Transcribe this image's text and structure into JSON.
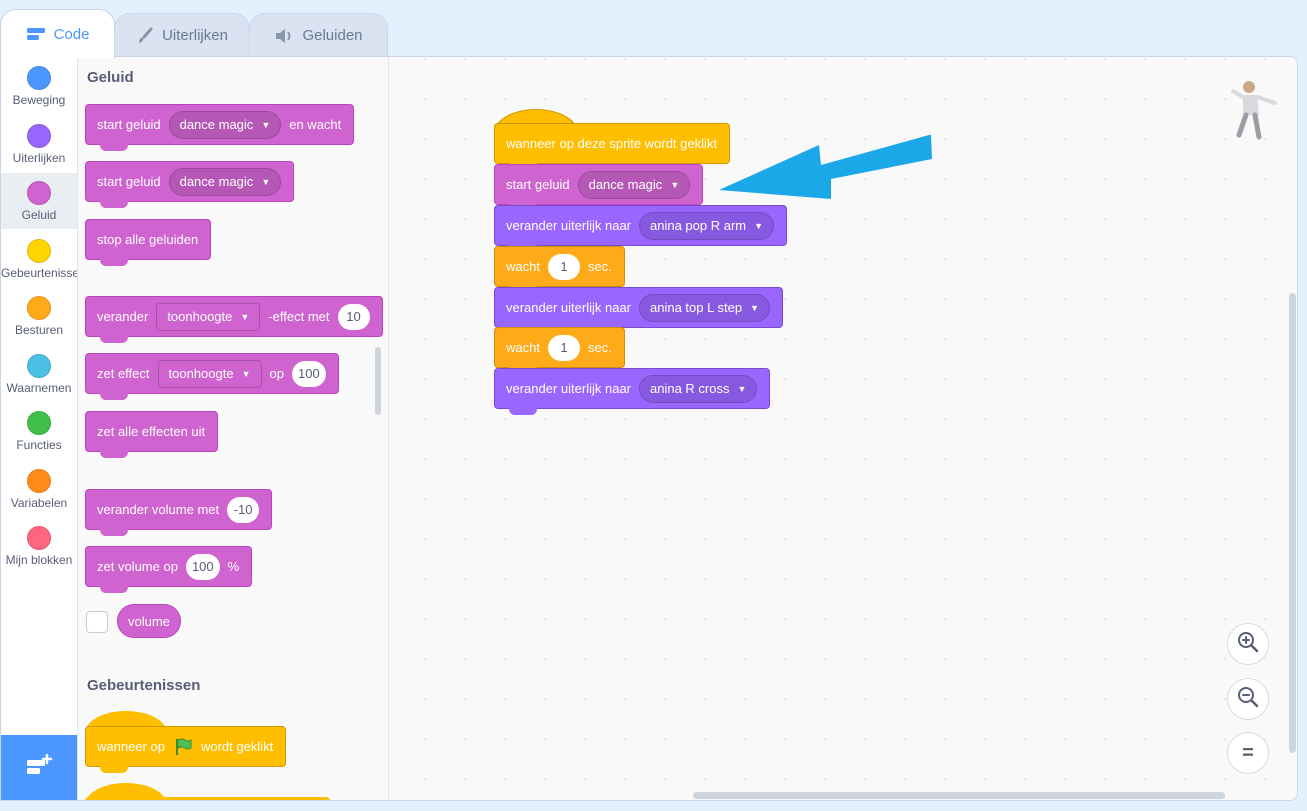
{
  "tabs": [
    {
      "label": "Code",
      "icon": "code-icon"
    },
    {
      "label": "Uiterlijken",
      "icon": "brush-icon"
    },
    {
      "label": "Geluiden",
      "icon": "speaker-icon"
    }
  ],
  "categories": [
    {
      "label": "Beweging",
      "color": "#4c97ff"
    },
    {
      "label": "Uiterlijken",
      "color": "#9966ff"
    },
    {
      "label": "Geluid",
      "color": "#cf63cf"
    },
    {
      "label": "Gebeurtenissen",
      "color": "#ffd500"
    },
    {
      "label": "Besturen",
      "color": "#ffab19"
    },
    {
      "label": "Waarnemen",
      "color": "#4cbfe6"
    },
    {
      "label": "Functies",
      "color": "#40bf4a"
    },
    {
      "label": "Variabelen",
      "color": "#ff8c1a"
    },
    {
      "label": "Mijn blokken",
      "color": "#ff6680"
    }
  ],
  "palette": {
    "heading_sound": "Geluid",
    "b1": {
      "pre": "start geluid",
      "dd": "dance magic",
      "post": "en wacht"
    },
    "b2": {
      "pre": "start geluid",
      "dd": "dance magic"
    },
    "b3": {
      "pre": "stop alle geluiden"
    },
    "b4": {
      "pre": "verander",
      "dd": "toonhoogte",
      "mid": "-effect met",
      "num": "10"
    },
    "b5": {
      "pre": "zet effect",
      "dd": "toonhoogte",
      "mid": "op",
      "num": "100"
    },
    "b6": {
      "pre": "zet alle effecten uit"
    },
    "b7": {
      "pre": "verander volume met",
      "num": "-10"
    },
    "b8": {
      "pre": "zet volume op",
      "num": "100",
      "post": "%"
    },
    "b9": {
      "reporter": "volume"
    },
    "heading_events": "Gebeurtenissen",
    "b10": {
      "pre": "wanneer op",
      "post": "wordt geklikt"
    }
  },
  "script": {
    "hat": "wanneer op deze sprite wordt geklikt",
    "s1": {
      "pre": "start geluid",
      "dd": "dance magic"
    },
    "s2": {
      "pre": "verander uiterlijk naar",
      "dd": "anina pop R arm"
    },
    "s3": {
      "pre": "wacht",
      "num": "1",
      "post": "sec."
    },
    "s4": {
      "pre": "verander uiterlijk naar",
      "dd": "anina top L step"
    },
    "s5": {
      "pre": "wacht",
      "num": "1",
      "post": "sec."
    },
    "s6": {
      "pre": "verander uiterlijk naar",
      "dd": "anina R cross"
    }
  },
  "zoom": {
    "reset_label": "="
  },
  "colors": {
    "accent": "#4c97ff",
    "arrow": "#1ba8e8"
  }
}
